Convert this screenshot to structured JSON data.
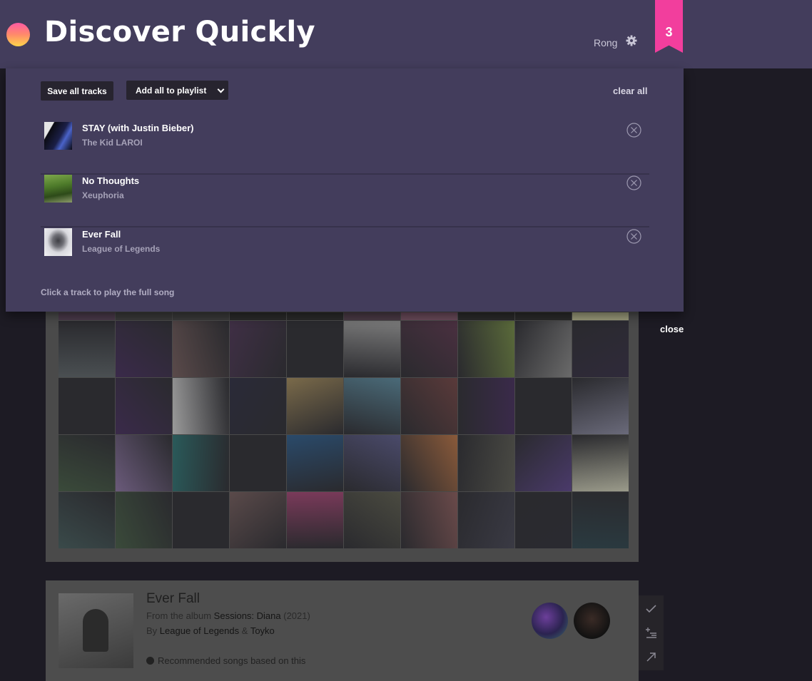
{
  "header": {
    "title": "Discover Quickly",
    "user": "Rong",
    "saved_count": "3",
    "brand_gradient": [
      "#ff5aa3",
      "#ff8a6a",
      "#ffd54a"
    ],
    "badge_color": "#f23e9d"
  },
  "panel": {
    "save_all_label": "Save all tracks",
    "add_playlist_label": "Add all to playlist",
    "clear_label": "clear all",
    "hint": "Click a track to play the full song",
    "tracks": [
      {
        "name": "STAY (with Justin Bieber)",
        "artist": "The Kid LAROI",
        "icon": "remove-icon"
      },
      {
        "name": "No Thoughts",
        "artist": "Xeuphoria",
        "icon": "remove-icon"
      },
      {
        "name": "Ever Fall",
        "artist": "League of Legends",
        "icon": "remove-icon"
      }
    ]
  },
  "grid": {
    "close_label": "close"
  },
  "now_playing": {
    "title": "Ever Fall",
    "album_prefix": "From the album",
    "album": "Sessions: Diana",
    "year": "(2021)",
    "by_prefix": "By",
    "artist_1": "League of Legends",
    "amp": "&",
    "artist_2": "Toyko",
    "recommend_label": "Recommended songs based on this",
    "tools": [
      "check-icon",
      "add-to-playlist-icon",
      "open-external-icon"
    ]
  }
}
